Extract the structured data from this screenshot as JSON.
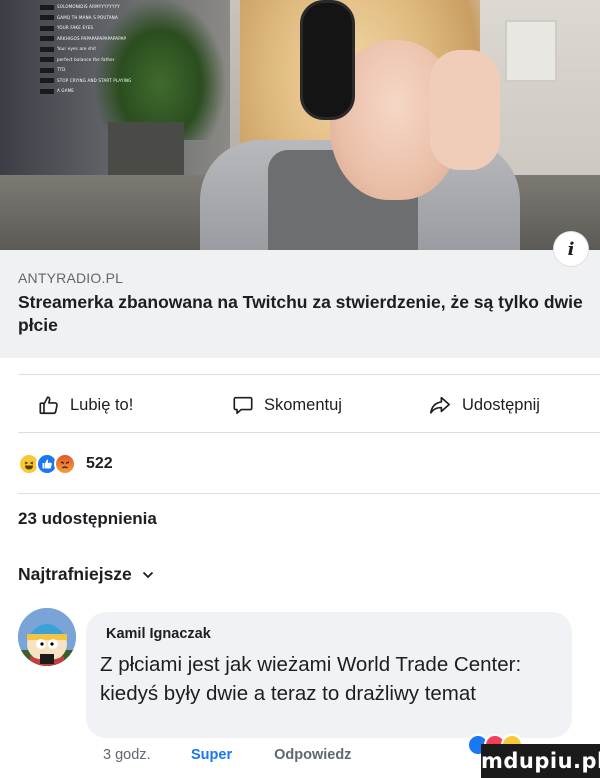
{
  "video": {
    "chat_lines": [
      "SOLOMONIDIS ARMYYYYYYYY",
      "GAMQ TH MANA S POUTANA",
      "YOUR FAKE EYES",
      "ARKHIGOS PAPAPAPAPAPAPAPAP",
      "Your eyes are shit",
      "perfect balance the father",
      "TTD",
      "STOP CRYING AND START PLAYING",
      "A GAME"
    ]
  },
  "post": {
    "info_icon": "i",
    "link_domain": "ANTYRADIO.PL",
    "link_title": "Streamerka zbanowana na Twitchu za stwierdzenie, że są tylko dwie płcie"
  },
  "actions": {
    "like_label": "Lubię to!",
    "comment_label": "Skomentuj",
    "share_label": "Udostępnij"
  },
  "reactions": {
    "count": "522",
    "types": [
      "haha",
      "like",
      "angry"
    ]
  },
  "shares_label": "23 udostępnienia",
  "comments_sort_label": "Najtrafniejsze",
  "comment": {
    "author": "Kamil Ignaczak",
    "text": "Z płciami jest jak wieżami World Trade Center: kiedyś były dwie a teraz to drażliwy temat",
    "time": "3 godz.",
    "reaction_action": "Super",
    "reply_action": "Odpowiedz"
  },
  "watermark": "mdupiu.pl",
  "colors": {
    "accent": "#1877f2",
    "text": "#1c1e21",
    "muted": "#606770",
    "link_box_bg": "#f0f1f3",
    "bubble_bg": "#f0f2f5"
  }
}
